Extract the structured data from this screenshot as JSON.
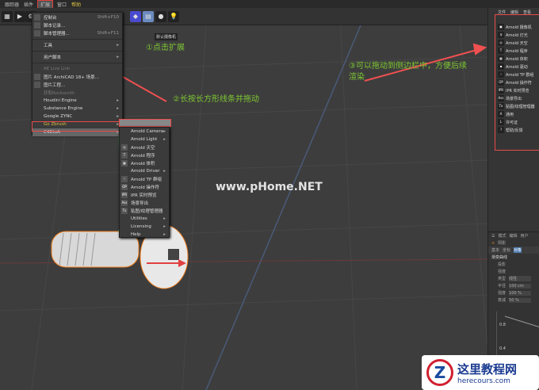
{
  "menubar": {
    "items": [
      "跟踪器",
      "插件",
      "扩展",
      "窗口",
      "帮助"
    ]
  },
  "extend_menu": {
    "items": [
      {
        "label": "控制台",
        "shortcut": "Shift+F10",
        "icon": "console"
      },
      {
        "label": "脚本记录...",
        "icon": "script-log"
      },
      {
        "label": "脚本管理器...",
        "shortcut": "Shift+F11",
        "icon": "script-manager"
      },
      {
        "label": "工具",
        "submenu": true
      },
      {
        "label": "用户脚本",
        "submenu": true
      },
      {
        "label": "AE Live Link",
        "disabled": true
      },
      {
        "label": "图片 ArchiCAD 18+ 场景...",
        "icon": "archicad"
      },
      {
        "label": "图片工程...",
        "icon": "project"
      },
      {
        "label": "获取Rocksmith",
        "disabled": true
      },
      {
        "label": "Houdini Engine",
        "submenu": true
      },
      {
        "label": "Substance Engine",
        "submenu": true
      },
      {
        "label": "Google ZYNC",
        "submenu": true
      },
      {
        "label": "Go Zbrush",
        "submenu": true,
        "highlight": true
      },
      {
        "label": "C4DtoA",
        "submenu": true
      }
    ]
  },
  "arnold_menu": {
    "items": [
      {
        "label": "Arnold Camera",
        "submenu": true
      },
      {
        "label": "Arnold Light",
        "submenu": true
      },
      {
        "label": "Arnold 天空",
        "icon": "◎"
      },
      {
        "label": "Arnold 程序",
        "icon": "T"
      },
      {
        "label": "Arnold 体积",
        "icon": "▦"
      },
      {
        "label": "Arnold Driver",
        "submenu": true
      },
      {
        "label": "Arnold TP 群组",
        "icon": "⁘"
      },
      {
        "label": "Arnold 操作符",
        "icon": "OP"
      },
      {
        "label": "IPR 实时预览",
        "icon": "IPR"
      },
      {
        "label": "场景导出",
        "icon": "Ass"
      },
      {
        "label": "贴图/纹理管理器",
        "icon": "Tx"
      },
      {
        "label": "Utilities",
        "submenu": true
      },
      {
        "label": "Licensing",
        "submenu": true
      },
      {
        "label": "Help",
        "submenu": true
      }
    ]
  },
  "tooltip": "默认摄像机",
  "annotations": {
    "step1": "①点击扩展",
    "step2": "②长按长方形线条并拖动",
    "step3": "③可以拖动到侧边栏中，方便后续渲染"
  },
  "right_panel": {
    "tabs": [
      "文件",
      "编辑",
      "查看"
    ],
    "items": [
      {
        "label": "Arnold 摄像机",
        "icon": "▣"
      },
      {
        "label": "Arnold 灯光",
        "icon": "♀"
      },
      {
        "label": "Arnold 天空",
        "icon": "◎"
      },
      {
        "label": "Arnold 程序",
        "icon": "T"
      },
      {
        "label": "Arnold 体积",
        "icon": "▦"
      },
      {
        "label": "Arnold 驱动",
        "icon": "▪"
      },
      {
        "label": "Arnold TP 群组",
        "icon": "⁘"
      },
      {
        "label": "Arnold 操作符",
        "icon": "OP"
      },
      {
        "label": "IPR 实时预览",
        "icon": "IPR"
      },
      {
        "label": "场景导出",
        "icon": "Ass"
      },
      {
        "label": "贴图/纹理管理器",
        "icon": "Tx"
      },
      {
        "label": "通用",
        "icon": "A"
      },
      {
        "label": "许可证",
        "icon": "L"
      },
      {
        "label": "帮助/反馈",
        "icon": "?"
      }
    ]
  },
  "attributes": {
    "tabs": [
      "模式",
      "编辑",
      "用户"
    ],
    "object": "阴影",
    "subtabs": [
      "基本",
      "坐标",
      "对象"
    ],
    "section": "渐变曲线",
    "fields": [
      {
        "label": "投影",
        "value": ""
      },
      {
        "label": "强度",
        "value": ""
      },
      {
        "label": "类型",
        "value": "线性"
      },
      {
        "label": "半径",
        "value": "100 cm"
      },
      {
        "label": "强度",
        "value": "100 %"
      },
      {
        "label": "衰减",
        "value": "50 %"
      }
    ],
    "graph_ticks": [
      "0.8",
      "0.4"
    ]
  },
  "watermark": "www.pHome.NET",
  "logo": {
    "title": "这里教程网",
    "url": "herecours.com"
  }
}
